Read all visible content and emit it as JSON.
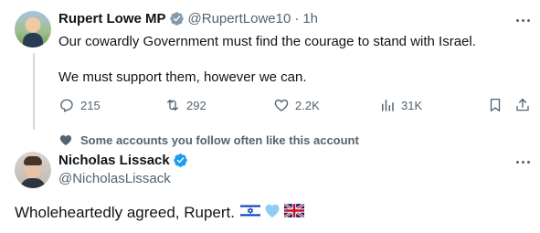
{
  "tweet": {
    "author_name": "Rupert Lowe MP",
    "author_handle": "@RupertLowe10",
    "separator": "·",
    "time": "1h",
    "line1": "Our cowardly Government must find the courage to stand with Israel.",
    "line2": "We must support them, however we can.",
    "actions": {
      "replies": "215",
      "reposts": "292",
      "likes": "2.2K",
      "views": "31K"
    },
    "verified_color": "#829aab"
  },
  "social_context": {
    "label": "Some accounts you follow often like this account"
  },
  "reply": {
    "author_name": "Nicholas Lissack",
    "author_handle": "@NicholasLissack",
    "text": "Wholeheartedly agreed, Rupert.",
    "emojis": [
      "flag-israel",
      "light-blue-heart",
      "flag-uk"
    ],
    "verified_color": "#1d9bf0"
  },
  "icons": {
    "reply": "reply-icon",
    "repost": "repost-icon",
    "like": "heart-icon",
    "views": "views-icon",
    "bookmark": "bookmark-icon",
    "share": "share-icon",
    "more": "more-icon"
  }
}
